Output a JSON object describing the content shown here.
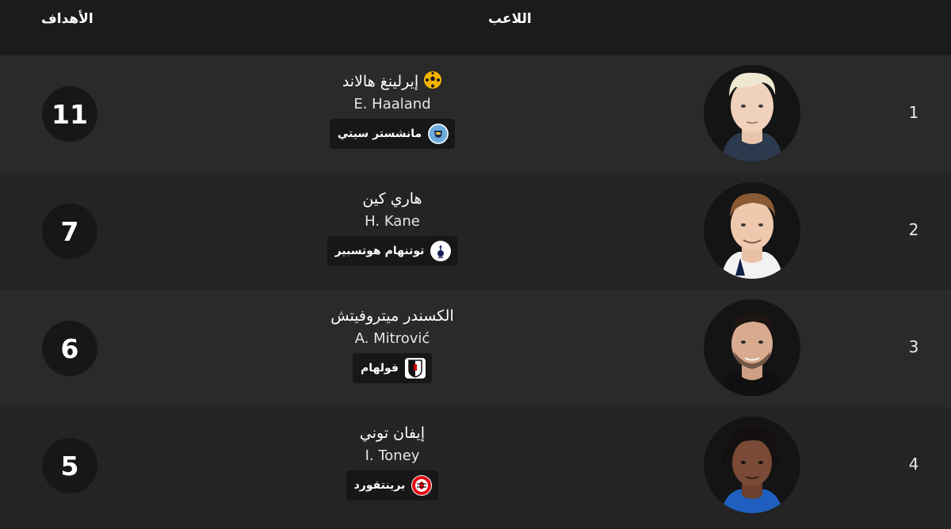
{
  "header": {
    "goals_label": "الأهداف",
    "player_label": "اللاعب"
  },
  "rows": [
    {
      "rank": "1",
      "name_ar": "إيرلينغ هالاند",
      "name_en": "E. Haaland",
      "club": "مانشستر سيتي",
      "goals": "11",
      "crest": "man-city-crest-icon"
    },
    {
      "rank": "2",
      "name_ar": "هاري كين",
      "name_en": "H. Kane",
      "club": "توتنهام هوتسبير",
      "goals": "7",
      "crest": "tottenham-crest-icon"
    },
    {
      "rank": "3",
      "name_ar": "الكسندر ميتروفيتش",
      "name_en": "A. Mitrović",
      "club": "فولهام",
      "goals": "6",
      "crest": "fulham-crest-icon"
    },
    {
      "rank": "4",
      "name_ar": "إيفان توني",
      "name_en": "I. Toney",
      "club": "برينتفورد",
      "goals": "5",
      "crest": "brentford-crest-icon"
    }
  ],
  "colors": {
    "row_odd": "#2a2a2a",
    "row_even": "#242424",
    "ball_icon": "#f5b400"
  }
}
